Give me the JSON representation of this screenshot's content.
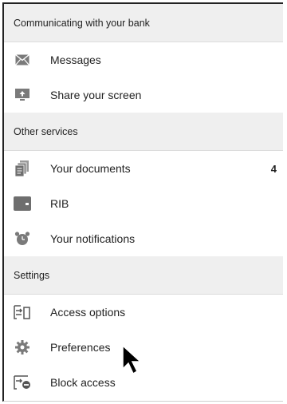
{
  "sections": [
    {
      "title": "Communicating with your bank",
      "items": [
        {
          "label": "Messages",
          "icon": "envelope-icon"
        },
        {
          "label": "Share your screen",
          "icon": "screen-share-icon"
        }
      ]
    },
    {
      "title": "Other services",
      "items": [
        {
          "label": "Your documents",
          "icon": "documents-icon",
          "badge": "4"
        },
        {
          "label": "RIB",
          "icon": "wallet-icon"
        },
        {
          "label": "Your notifications",
          "icon": "alarm-clock-icon"
        }
      ]
    },
    {
      "title": "Settings",
      "items": [
        {
          "label": "Access options",
          "icon": "access-options-icon"
        },
        {
          "label": "Preferences",
          "icon": "gear-icon"
        },
        {
          "label": "Block access",
          "icon": "block-access-icon"
        }
      ]
    }
  ],
  "colors": {
    "header_bg": "#efefef",
    "icon_gray": "#7a7a7a"
  }
}
